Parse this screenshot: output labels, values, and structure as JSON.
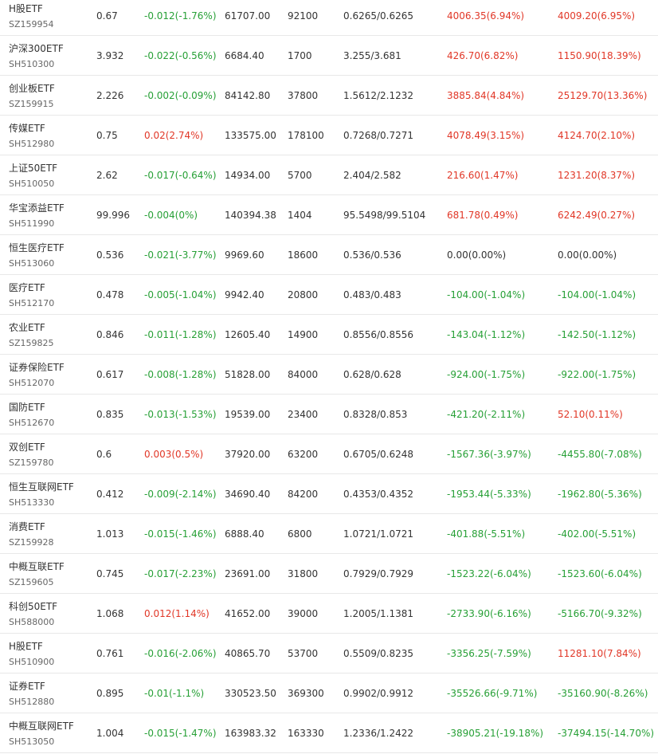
{
  "colors": {
    "up": "#e13727",
    "down": "#27a036",
    "flat": "#333333"
  },
  "rows": [
    {
      "name": "H股ETF",
      "code": "SZ159954",
      "price": "0.67",
      "change": "-0.012(-1.76%)",
      "change_dir": "down",
      "amount": "61707.00",
      "volume": "92100",
      "nav": "0.6265/0.6265",
      "flow1": "4006.35(6.94%)",
      "flow1_dir": "up",
      "flow2": "4009.20(6.95%)",
      "flow2_dir": "up"
    },
    {
      "name": "沪深300ETF",
      "code": "SH510300",
      "price": "3.932",
      "change": "-0.022(-0.56%)",
      "change_dir": "down",
      "amount": "6684.40",
      "volume": "1700",
      "nav": "3.255/3.681",
      "flow1": "426.70(6.82%)",
      "flow1_dir": "up",
      "flow2": "1150.90(18.39%)",
      "flow2_dir": "up"
    },
    {
      "name": "创业板ETF",
      "code": "SZ159915",
      "price": "2.226",
      "change": "-0.002(-0.09%)",
      "change_dir": "down",
      "amount": "84142.80",
      "volume": "37800",
      "nav": "1.5612/2.1232",
      "flow1": "3885.84(4.84%)",
      "flow1_dir": "up",
      "flow2": "25129.70(13.36%)",
      "flow2_dir": "up"
    },
    {
      "name": "传媒ETF",
      "code": "SH512980",
      "price": "0.75",
      "change": "0.02(2.74%)",
      "change_dir": "up",
      "amount": "133575.00",
      "volume": "178100",
      "nav": "0.7268/0.7271",
      "flow1": "4078.49(3.15%)",
      "flow1_dir": "up",
      "flow2": "4124.70(2.10%)",
      "flow2_dir": "up"
    },
    {
      "name": "上证50ETF",
      "code": "SH510050",
      "price": "2.62",
      "change": "-0.017(-0.64%)",
      "change_dir": "down",
      "amount": "14934.00",
      "volume": "5700",
      "nav": "2.404/2.582",
      "flow1": "216.60(1.47%)",
      "flow1_dir": "up",
      "flow2": "1231.20(8.37%)",
      "flow2_dir": "up"
    },
    {
      "name": "华宝添益ETF",
      "code": "SH511990",
      "price": "99.996",
      "change": "-0.004(0%)",
      "change_dir": "down",
      "amount": "140394.38",
      "volume": "1404",
      "nav": "95.5498/99.5104",
      "flow1": "681.78(0.49%)",
      "flow1_dir": "up",
      "flow2": "6242.49(0.27%)",
      "flow2_dir": "up"
    },
    {
      "name": "恒生医疗ETF",
      "code": "SH513060",
      "price": "0.536",
      "change": "-0.021(-3.77%)",
      "change_dir": "down",
      "amount": "9969.60",
      "volume": "18600",
      "nav": "0.536/0.536",
      "flow1": "0.00(0.00%)",
      "flow1_dir": "flat",
      "flow2": "0.00(0.00%)",
      "flow2_dir": "flat"
    },
    {
      "name": "医疗ETF",
      "code": "SH512170",
      "price": "0.478",
      "change": "-0.005(-1.04%)",
      "change_dir": "down",
      "amount": "9942.40",
      "volume": "20800",
      "nav": "0.483/0.483",
      "flow1": "-104.00(-1.04%)",
      "flow1_dir": "down",
      "flow2": "-104.00(-1.04%)",
      "flow2_dir": "down"
    },
    {
      "name": "农业ETF",
      "code": "SZ159825",
      "price": "0.846",
      "change": "-0.011(-1.28%)",
      "change_dir": "down",
      "amount": "12605.40",
      "volume": "14900",
      "nav": "0.8556/0.8556",
      "flow1": "-143.04(-1.12%)",
      "flow1_dir": "down",
      "flow2": "-142.50(-1.12%)",
      "flow2_dir": "down"
    },
    {
      "name": "证券保险ETF",
      "code": "SH512070",
      "price": "0.617",
      "change": "-0.008(-1.28%)",
      "change_dir": "down",
      "amount": "51828.00",
      "volume": "84000",
      "nav": "0.628/0.628",
      "flow1": "-924.00(-1.75%)",
      "flow1_dir": "down",
      "flow2": "-922.00(-1.75%)",
      "flow2_dir": "down"
    },
    {
      "name": "国防ETF",
      "code": "SH512670",
      "price": "0.835",
      "change": "-0.013(-1.53%)",
      "change_dir": "down",
      "amount": "19539.00",
      "volume": "23400",
      "nav": "0.8328/0.853",
      "flow1": "-421.20(-2.11%)",
      "flow1_dir": "down",
      "flow2": "52.10(0.11%)",
      "flow2_dir": "up"
    },
    {
      "name": "双创ETF",
      "code": "SZ159780",
      "price": "0.6",
      "change": "0.003(0.5%)",
      "change_dir": "up",
      "amount": "37920.00",
      "volume": "63200",
      "nav": "0.6705/0.6248",
      "flow1": "-1567.36(-3.97%)",
      "flow1_dir": "down",
      "flow2": "-4455.80(-7.08%)",
      "flow2_dir": "down"
    },
    {
      "name": "恒生互联网ETF",
      "code": "SH513330",
      "price": "0.412",
      "change": "-0.009(-2.14%)",
      "change_dir": "down",
      "amount": "34690.40",
      "volume": "84200",
      "nav": "0.4353/0.4352",
      "flow1": "-1953.44(-5.33%)",
      "flow1_dir": "down",
      "flow2": "-1962.80(-5.36%)",
      "flow2_dir": "down"
    },
    {
      "name": "消费ETF",
      "code": "SZ159928",
      "price": "1.013",
      "change": "-0.015(-1.46%)",
      "change_dir": "down",
      "amount": "6888.40",
      "volume": "6800",
      "nav": "1.0721/1.0721",
      "flow1": "-401.88(-5.51%)",
      "flow1_dir": "down",
      "flow2": "-402.00(-5.51%)",
      "flow2_dir": "down"
    },
    {
      "name": "中概互联ETF",
      "code": "SZ159605",
      "price": "0.745",
      "change": "-0.017(-2.23%)",
      "change_dir": "down",
      "amount": "23691.00",
      "volume": "31800",
      "nav": "0.7929/0.7929",
      "flow1": "-1523.22(-6.04%)",
      "flow1_dir": "down",
      "flow2": "-1523.60(-6.04%)",
      "flow2_dir": "down"
    },
    {
      "name": "科创50ETF",
      "code": "SH588000",
      "price": "1.068",
      "change": "0.012(1.14%)",
      "change_dir": "up",
      "amount": "41652.00",
      "volume": "39000",
      "nav": "1.2005/1.1381",
      "flow1": "-2733.90(-6.16%)",
      "flow1_dir": "down",
      "flow2": "-5166.70(-9.32%)",
      "flow2_dir": "down"
    },
    {
      "name": "H股ETF",
      "code": "SH510900",
      "price": "0.761",
      "change": "-0.016(-2.06%)",
      "change_dir": "down",
      "amount": "40865.70",
      "volume": "53700",
      "nav": "0.5509/0.8235",
      "flow1": "-3356.25(-7.59%)",
      "flow1_dir": "down",
      "flow2": "11281.10(7.84%)",
      "flow2_dir": "up"
    },
    {
      "name": "证券ETF",
      "code": "SH512880",
      "price": "0.895",
      "change": "-0.01(-1.1%)",
      "change_dir": "down",
      "amount": "330523.50",
      "volume": "369300",
      "nav": "0.9902/0.9912",
      "flow1": "-35526.66(-9.71%)",
      "flow1_dir": "down",
      "flow2": "-35160.90(-8.26%)",
      "flow2_dir": "down"
    },
    {
      "name": "中概互联网ETF",
      "code": "SH513050",
      "price": "1.004",
      "change": "-0.015(-1.47%)",
      "change_dir": "down",
      "amount": "163983.32",
      "volume": "163330",
      "nav": "1.2336/1.2422",
      "flow1": "-38905.21(-19.18%)",
      "flow1_dir": "down",
      "flow2": "-37494.15(-14.70%)",
      "flow2_dir": "down"
    }
  ]
}
